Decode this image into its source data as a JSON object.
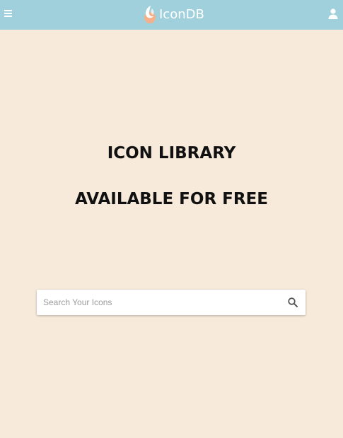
{
  "header": {
    "brand_name": "IconDB",
    "menu_icon": "hamburger-menu-icon",
    "user_icon": "user-icon",
    "logo_icon": "icondb-logo-icon",
    "bar_color": "#a0d0dc"
  },
  "hero": {
    "line1": "ICON LIBRARY",
    "line2": "AVAILABLE FOR FREE"
  },
  "search": {
    "placeholder": "Search Your Icons",
    "value": "",
    "icon": "search-icon"
  },
  "colors": {
    "background": "#f7eadb",
    "heading": "#111111",
    "header": "#a0d0dc"
  }
}
